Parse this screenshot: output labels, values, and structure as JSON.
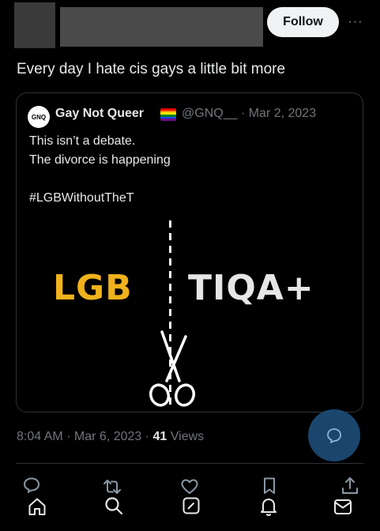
{
  "header": {
    "follow_label": "Follow",
    "more_label": "···"
  },
  "tweet": {
    "text": "Every day I hate cis gays a little bit more",
    "timestamp": "8:04 AM · Mar 6, 2023 · ",
    "views_count": "41",
    "views_label": " Views"
  },
  "quote": {
    "avatar_text": "GNQ",
    "name": "Gay Not Queer",
    "handle_date": "@GNQ__ · Mar 2, 2023",
    "lines": [
      "This isn’t a debate.",
      "The divorce is happening",
      "#LGBWithoutTheT"
    ],
    "image": {
      "left_text": "LGB",
      "right_text": "TIQA+"
    }
  },
  "colors": {
    "background": "#000000",
    "text": "#e7e9ea",
    "muted": "#71767b",
    "accent": "#1d9bf0",
    "lgb_gold": "#f0b21c"
  },
  "actions": {
    "icons_top": [
      "reply-icon",
      "retweet-icon",
      "like-icon",
      "bookmark-icon",
      "share-icon"
    ],
    "icons_bottom": [
      "home-icon",
      "search-icon",
      "compose-icon",
      "notifications-icon",
      "messages-icon"
    ]
  }
}
